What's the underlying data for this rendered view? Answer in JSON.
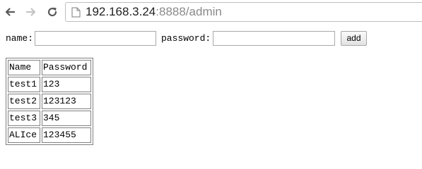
{
  "browser": {
    "url_host": "192.168.3.24",
    "url_rest": ":8888/admin",
    "icons": {
      "back": "arrow-left-icon",
      "forward": "arrow-right-icon",
      "reload": "reload-icon",
      "page": "page-icon"
    }
  },
  "form": {
    "name_label": "name:",
    "name_value": "",
    "password_label": "password:",
    "password_value": "",
    "add_label": "add"
  },
  "table": {
    "headers": [
      "Name",
      "Password"
    ],
    "rows": [
      [
        "test1",
        "123"
      ],
      [
        "test2",
        "123123"
      ],
      [
        "test3",
        "345"
      ],
      [
        "ALIce",
        "123455"
      ]
    ]
  }
}
